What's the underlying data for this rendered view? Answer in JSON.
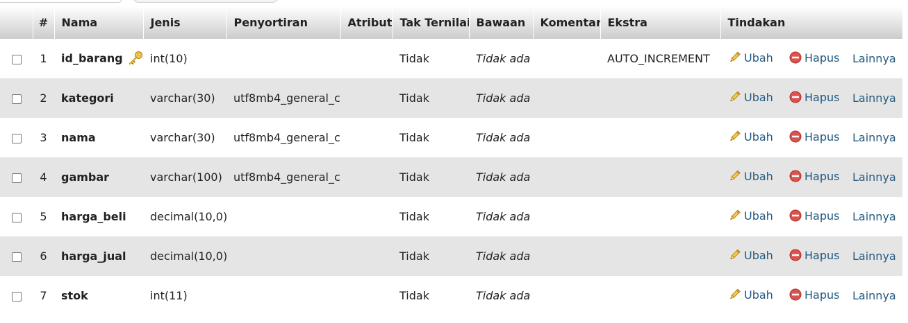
{
  "table": {
    "headers": {
      "num": "#",
      "name": "Nama",
      "type": "Jenis",
      "collation": "Penyortiran",
      "attributes": "Atribut",
      "null": "Tak Ternilai",
      "default": "Bawaan",
      "comments": "Komentar",
      "extra": "Ekstra",
      "actions": "Tindakan"
    },
    "actions": {
      "change": "Ubah",
      "drop": "Hapus",
      "more": "Lainnya"
    },
    "rows": [
      {
        "num": "1",
        "name": "id_barang",
        "primary_key": true,
        "type": "int(10)",
        "collation": "",
        "attributes": "",
        "null": "Tidak",
        "default": "Tidak ada",
        "comments": "",
        "extra": "AUTO_INCREMENT"
      },
      {
        "num": "2",
        "name": "kategori",
        "primary_key": false,
        "type": "varchar(30)",
        "collation": "utf8mb4_general_ci",
        "attributes": "",
        "null": "Tidak",
        "default": "Tidak ada",
        "comments": "",
        "extra": ""
      },
      {
        "num": "3",
        "name": "nama",
        "primary_key": false,
        "type": "varchar(30)",
        "collation": "utf8mb4_general_ci",
        "attributes": "",
        "null": "Tidak",
        "default": "Tidak ada",
        "comments": "",
        "extra": ""
      },
      {
        "num": "4",
        "name": "gambar",
        "primary_key": false,
        "type": "varchar(100)",
        "collation": "utf8mb4_general_ci",
        "attributes": "",
        "null": "Tidak",
        "default": "Tidak ada",
        "comments": "",
        "extra": ""
      },
      {
        "num": "5",
        "name": "harga_beli",
        "primary_key": false,
        "type": "decimal(10,0)",
        "collation": "",
        "attributes": "",
        "null": "Tidak",
        "default": "Tidak ada",
        "comments": "",
        "extra": ""
      },
      {
        "num": "6",
        "name": "harga_jual",
        "primary_key": false,
        "type": "decimal(10,0)",
        "collation": "",
        "attributes": "",
        "null": "Tidak",
        "default": "Tidak ada",
        "comments": "",
        "extra": ""
      },
      {
        "num": "7",
        "name": "stok",
        "primary_key": false,
        "type": "int(11)",
        "collation": "",
        "attributes": "",
        "null": "Tidak",
        "default": "Tidak ada",
        "comments": "",
        "extra": ""
      }
    ]
  },
  "icons": {
    "primary_key": "key-icon",
    "change": "pencil-icon",
    "drop": "drop-icon"
  },
  "colors": {
    "link": "#235a81",
    "row_alt": "#e5e5e5",
    "drop_icon": "#d9534f",
    "key_icon": "#e4b437"
  }
}
